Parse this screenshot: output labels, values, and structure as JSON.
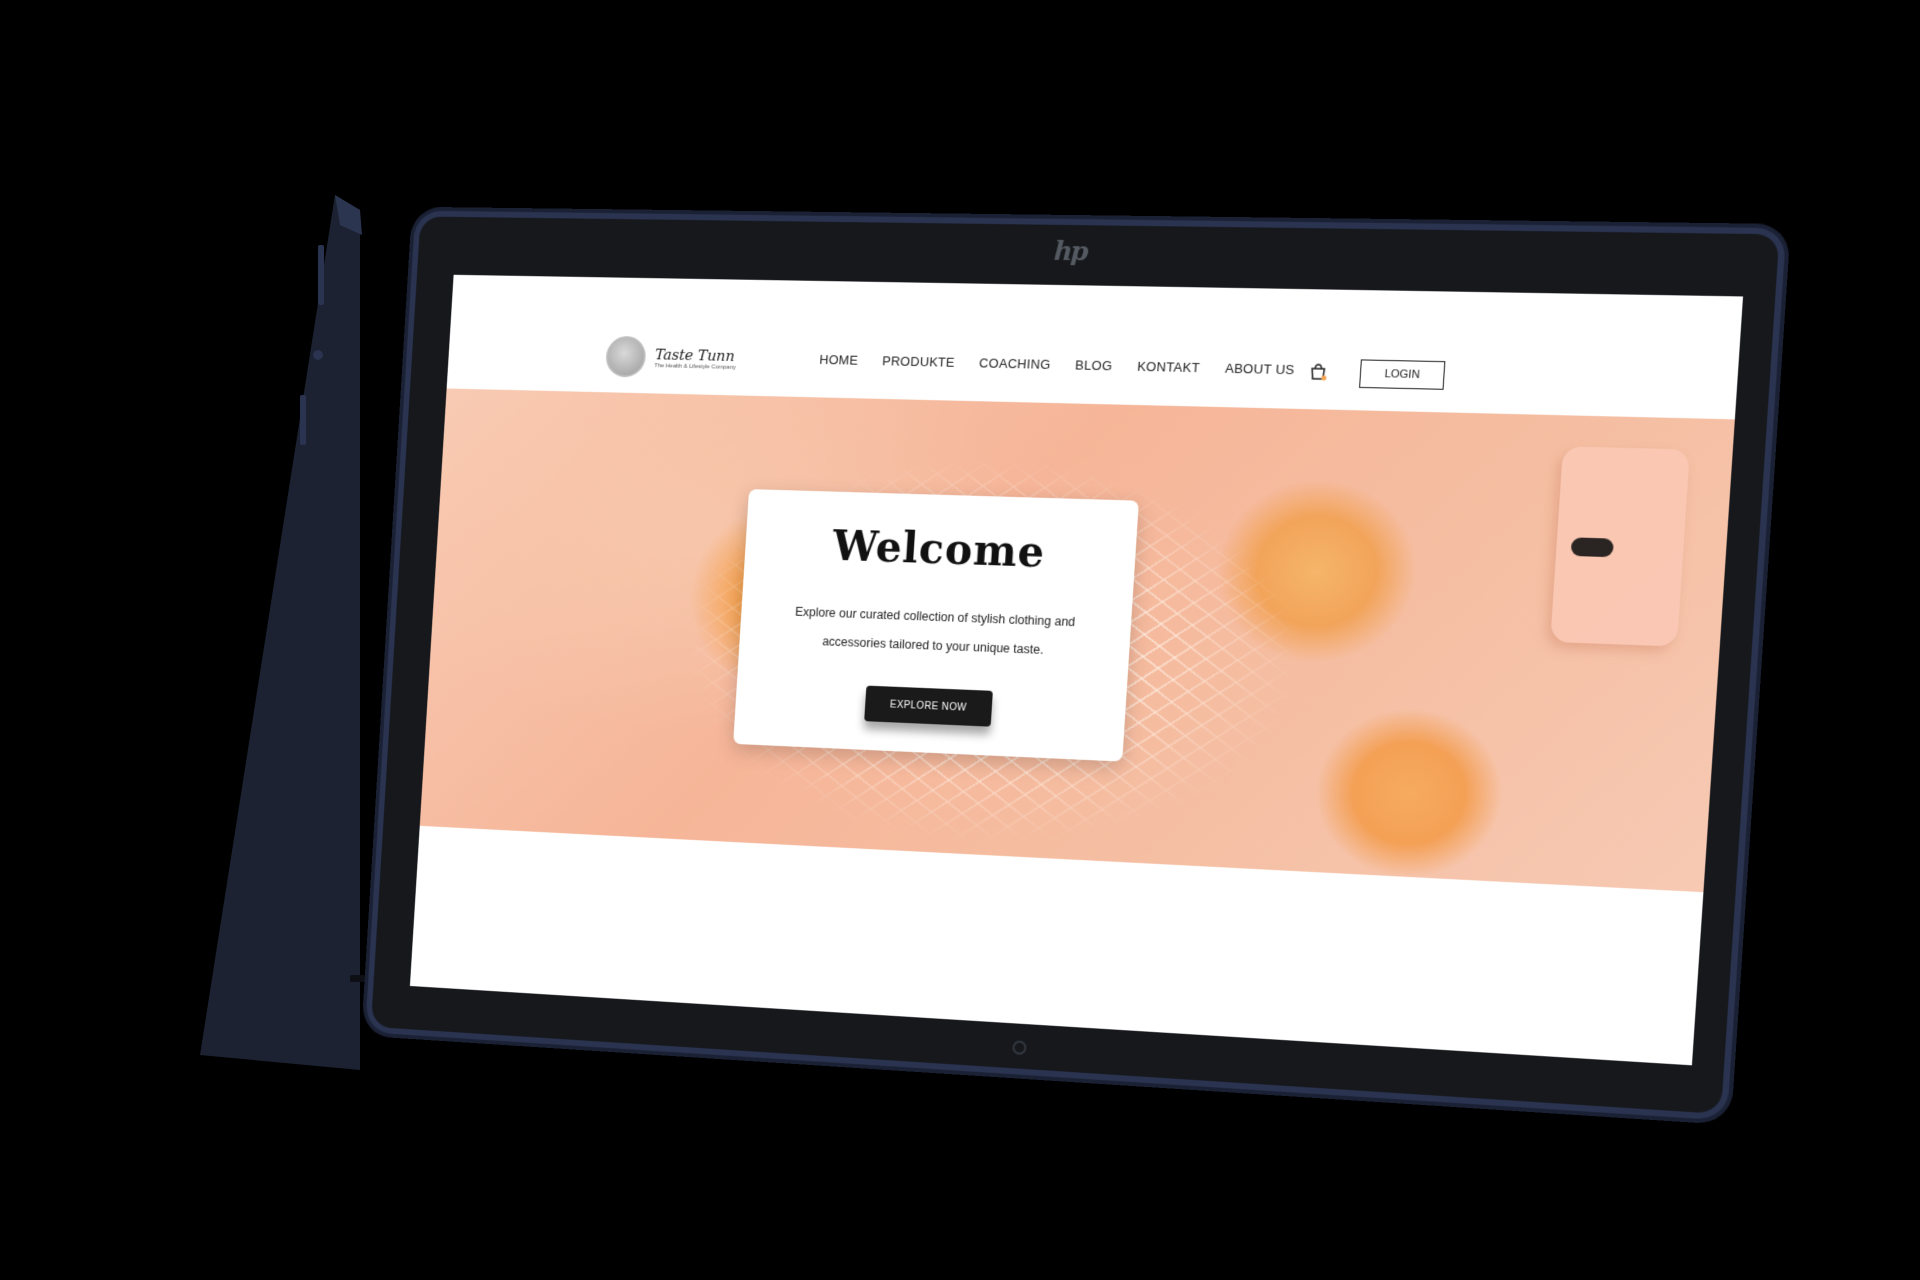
{
  "device": {
    "brand_logo": "hp",
    "body_color": "#1e2436"
  },
  "site": {
    "brand": {
      "name": "Taste Tunn",
      "tagline": "The Health & Lifestyle Company"
    },
    "nav": {
      "items": [
        {
          "label": "HOME"
        },
        {
          "label": "PRODUKTE"
        },
        {
          "label": "COACHING"
        },
        {
          "label": "BLOG"
        },
        {
          "label": "KONTAKT"
        },
        {
          "label": "ABOUT US"
        }
      ],
      "cart_icon": "shopping-bag-icon",
      "login_label": "LOGIN"
    },
    "hero": {
      "title": "Welcome",
      "text": "Explore our curated collection of stylish clothing and accessories tailored to your unique taste.",
      "cta_label": "EXPLORE NOW"
    },
    "colors": {
      "hero_peach": "#f6b598",
      "cta_background": "#1a1a1a",
      "accent_orange": "#f5a455"
    }
  }
}
